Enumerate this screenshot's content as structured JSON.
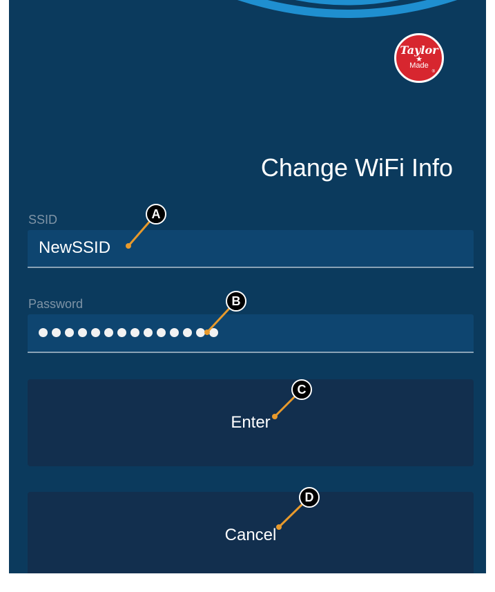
{
  "logo": {
    "line1": "Taylor",
    "star": "★",
    "line2": "Made",
    "reg": "®"
  },
  "title": "Change WiFi Info",
  "ssid": {
    "label": "SSID",
    "value": "NewSSID"
  },
  "password": {
    "label": "Password",
    "masked_length": 14
  },
  "buttons": {
    "enter": "Enter",
    "cancel": "Cancel"
  },
  "callouts": {
    "a": "A",
    "b": "B",
    "c": "C",
    "d": "D"
  },
  "colors": {
    "background": "#0b3a5d",
    "button": "#122f4e",
    "field": "#0e4570",
    "callout_line": "#e89a2c",
    "logo": "#d7262f"
  }
}
